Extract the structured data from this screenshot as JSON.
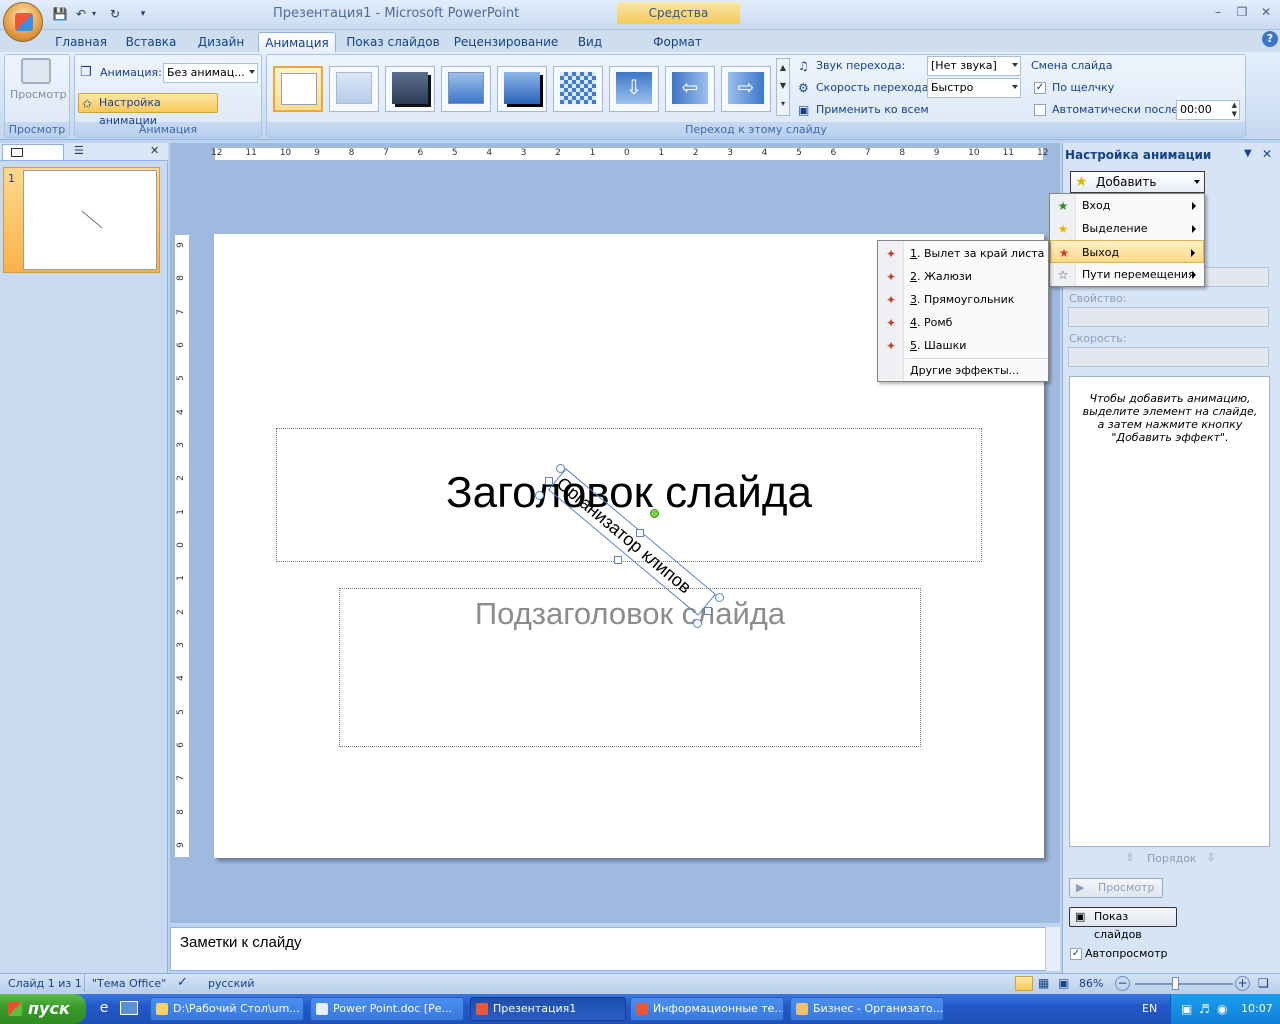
{
  "window": {
    "title": "Презентация1 - Microsoft PowerPoint",
    "tools_tab": "Средства рисования"
  },
  "ribbon_tabs": [
    "Главная",
    "Вставка",
    "Дизайн",
    "Анимация",
    "Показ слайдов",
    "Рецензирование",
    "Вид",
    "Формат"
  ],
  "ribbon": {
    "preview_group": {
      "button": "Просмотр",
      "label": "Просмотр"
    },
    "animation_group": {
      "animation_label": "Анимация:",
      "animation_value": "Без анимац...",
      "custom_button": "Настройка анимации",
      "label": "Анимация"
    },
    "transition_group": {
      "label": "Переход к этому слайду",
      "sound_label": "Звук перехода:",
      "sound_value": "[Нет звука]",
      "speed_label": "Скорость перехода:",
      "speed_value": "Быстро",
      "apply_all": "Применить ко всем"
    },
    "advance_group": {
      "title": "Смена слайда",
      "on_click": "По щелчку",
      "on_click_checked": true,
      "auto_after": "Автоматически после:",
      "auto_after_checked": false,
      "time": "00:00"
    }
  },
  "slides_pane": {
    "slide_number": "1"
  },
  "ruler": {
    "h_ticks": [
      "12",
      "11",
      "10",
      "9",
      "8",
      "7",
      "6",
      "5",
      "4",
      "3",
      "2",
      "1",
      "0",
      "1",
      "2",
      "3",
      "4",
      "5",
      "6",
      "7",
      "8",
      "9",
      "10",
      "11",
      "12"
    ],
    "v_ticks": [
      "9",
      "8",
      "7",
      "6",
      "5",
      "4",
      "3",
      "2",
      "1",
      "0",
      "1",
      "2",
      "3",
      "4",
      "5",
      "6",
      "7",
      "8",
      "9"
    ]
  },
  "slide": {
    "title": "Заголовок слайда",
    "subtitle": "Подзаголовок слайда",
    "rotated_text": "Организатор клипов"
  },
  "notes": {
    "text": "Заметки к слайду"
  },
  "task_pane": {
    "title": "Настройка анимации",
    "add_effect": "Добавить эффект",
    "property_label": "Свойство:",
    "speed_label": "Скорость:",
    "hint": "Чтобы добавить анимацию, выделите элемент на слайде, а затем нажмите кнопку \"Добавить эффект\".",
    "order_label": "Порядок",
    "preview_button": "Просмотр",
    "slideshow_button": "Показ слайдов",
    "autopreview": "Автопросмотр",
    "autopreview_checked": true
  },
  "add_effect_menu": {
    "items": [
      {
        "label": "Вход",
        "icon": "entrance-star-icon",
        "color": "#2e8b2e"
      },
      {
        "label": "Выделение",
        "icon": "emphasis-star-icon",
        "color": "#e6b800"
      },
      {
        "label": "Выход",
        "icon": "exit-star-icon",
        "color": "#d0402a",
        "highlighted": true
      },
      {
        "label": "Пути перемещения",
        "icon": "motion-path-star-icon",
        "color": "#444444"
      }
    ]
  },
  "exit_submenu": {
    "items": [
      {
        "num": "1",
        "label": "Вылет за край листа"
      },
      {
        "num": "2",
        "label": "Жалюзи"
      },
      {
        "num": "3",
        "label": "Прямоугольник"
      },
      {
        "num": "4",
        "label": "Ромб"
      },
      {
        "num": "5",
        "label": "Шашки"
      }
    ],
    "more": "Другие эффекты..."
  },
  "status_bar": {
    "slide_info": "Слайд 1 из 1",
    "theme": "\"Тема Office\"",
    "language": "русский",
    "zoom": "86%"
  },
  "taskbar": {
    "start": "пуск",
    "items": [
      {
        "label": "D:\\Рабочий Стол\\um...",
        "active": false
      },
      {
        "label": "Power Point.doc [Ре...",
        "active": false
      },
      {
        "label": "Презентация1",
        "active": true
      },
      {
        "label": "Информационные те...",
        "active": false
      },
      {
        "label": "Бизнес - Организато...",
        "active": false
      }
    ],
    "lang": "EN",
    "clock": "10:07"
  }
}
